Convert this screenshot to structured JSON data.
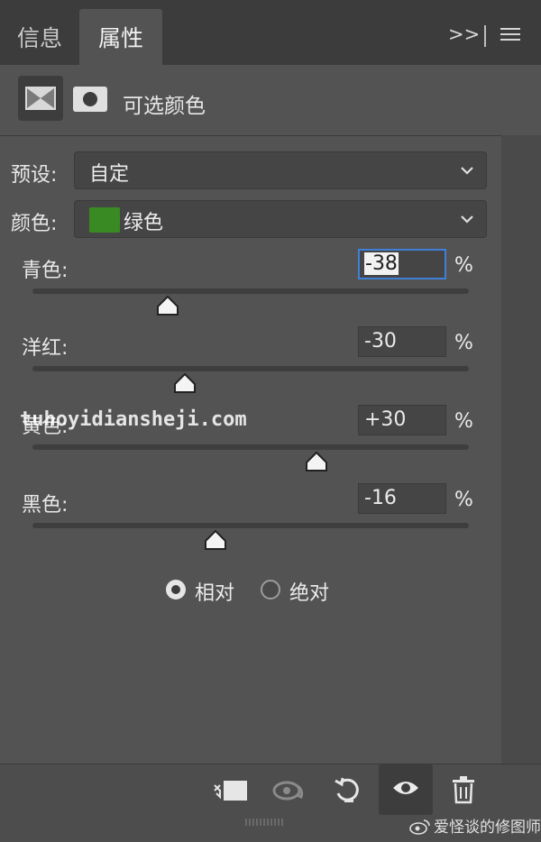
{
  "tabs": [
    {
      "label": "信息",
      "active": false
    },
    {
      "label": "属性",
      "active": true
    }
  ],
  "tab_actions": {
    "expand_icon": "double-chevron-right",
    "menu_icon": "hamburger-menu"
  },
  "panel": {
    "title": "可选颜色",
    "adjustment_icon": "selective-color-adjustment",
    "mask_icon": "layer-mask"
  },
  "preset": {
    "label": "预设:",
    "value": "自定"
  },
  "colors": {
    "label": "颜色:",
    "value": "绿色",
    "swatch_color": "#3a8a23"
  },
  "sliders": [
    {
      "label": "青色:",
      "value": "-38",
      "num": -38,
      "unit": "%",
      "focused": true
    },
    {
      "label": "洋红:",
      "value": "-30",
      "num": -30,
      "unit": "%",
      "focused": false
    },
    {
      "label": "黄色:",
      "value": "+30",
      "num": 30,
      "unit": "%",
      "focused": false
    },
    {
      "label": "黑色:",
      "value": "-16",
      "num": -16,
      "unit": "%",
      "focused": false
    }
  ],
  "slider_range": [
    -100,
    100
  ],
  "method": {
    "options": [
      {
        "label": "相对",
        "selected": true
      },
      {
        "label": "绝对",
        "selected": false
      }
    ]
  },
  "bottom_toolbar": {
    "icons": [
      "clip-to-layer-icon",
      "view-previous-state-icon",
      "reset-icon",
      "visibility-eye-icon",
      "trash-icon"
    ]
  },
  "watermark": "tuhoyidiansheji.com",
  "credit": "爱怪谈的修图师",
  "colors_theme": {
    "panel": "#535353",
    "tabbar": "#3c3c3c",
    "focus": "#3f7fd6"
  }
}
